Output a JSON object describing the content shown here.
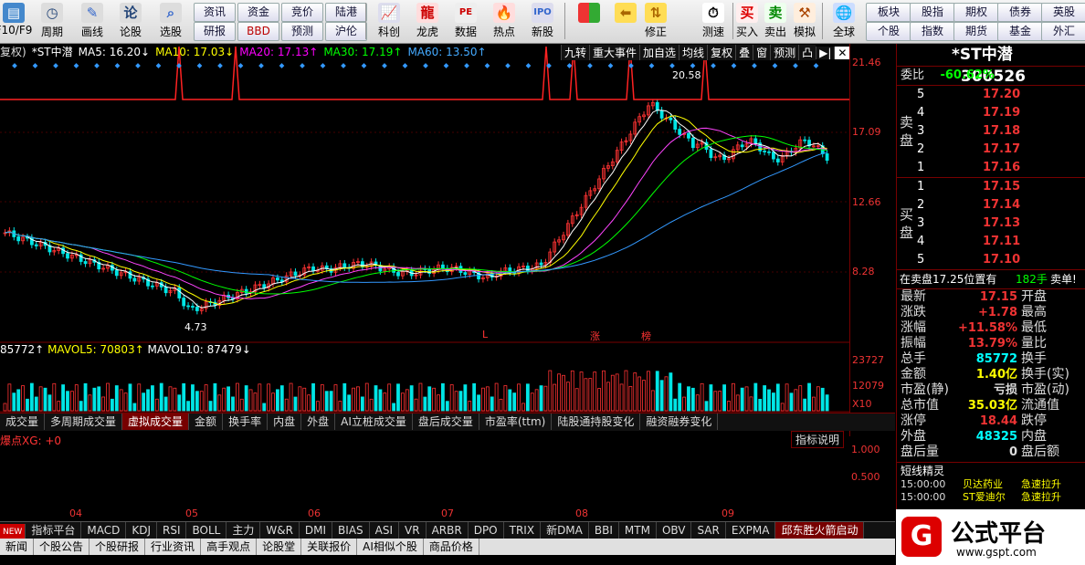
{
  "toolbar": {
    "buttons": [
      {
        "label": "F10/F9"
      },
      {
        "label": "周期"
      },
      {
        "label": "画线"
      },
      {
        "label": "论股"
      },
      {
        "label": "选股"
      },
      {
        "label": "科创"
      },
      {
        "label": "龙虎"
      },
      {
        "label": "数据"
      },
      {
        "label": "热点"
      },
      {
        "label": "新股"
      },
      {
        "label": "修正"
      },
      {
        "label": "测速"
      },
      {
        "label": "买入"
      },
      {
        "label": "卖出"
      },
      {
        "label": "模拟"
      },
      {
        "label": "全球"
      }
    ],
    "small": [
      "资讯",
      "资金",
      "竞价",
      "陆港",
      "研报",
      "BBD",
      "预测",
      "沪伦",
      "板块",
      "股指",
      "期权",
      "债券",
      "英股",
      "个股",
      "指数",
      "期货",
      "基金",
      "外汇"
    ]
  },
  "infobar": {
    "prefix": "复权)",
    "stock": "*ST中潜",
    "ma5": "MA5: 16.20↓",
    "ma10": "MA10: 17.03↓",
    "ma20": "MA20: 17.13↑",
    "ma30": "MA30: 17.19↑",
    "ma60": "MA60: 13.50↑"
  },
  "top_buttons": [
    "九转",
    "重大事件",
    "加自选",
    "均线",
    "复权",
    "叠",
    "窗",
    "预测",
    "凸"
  ],
  "price_axis": [
    "21.46",
    "17.09",
    "12.66",
    "8.28"
  ],
  "annotations": {
    "high": "20.58",
    "low": "4.73",
    "marker_l": "L",
    "marker_zhang": "涨",
    "marker_bang": "榜"
  },
  "volume": {
    "header_vol": "85772↑",
    "mavol5": "MAVOL5: 70803↑",
    "mavol10": "MAVOL10: 87479↓",
    "axis": [
      "23727",
      "12079",
      "X10"
    ]
  },
  "indicator_tabs": [
    "成交量",
    "多周期成交量",
    "虚拟成交量",
    "金额",
    "换手率",
    "内盘",
    "外盘",
    "AI立桩成交量",
    "盘后成交量",
    "市盈率(ttm)",
    "陆股通持股变化",
    "融资融券变化"
  ],
  "indicator": {
    "label": "爆点XG: +0",
    "help": "指标说明",
    "axis": [
      "1.000",
      "0.500"
    ]
  },
  "x_labels": [
    "04",
    "05",
    "06",
    "07",
    "08",
    "09"
  ],
  "bottom_tabs": [
    "NEW",
    "指标平台",
    "MACD",
    "KDJ",
    "RSI",
    "BOLL",
    "主力",
    "W&R",
    "DMI",
    "BIAS",
    "ASI",
    "VR",
    "ARBR",
    "DPO",
    "TRIX",
    "新DMA",
    "BBI",
    "MTM",
    "OBV",
    "SAR",
    "EXPMA",
    "邱东胜火箭启动"
  ],
  "news_tabs": [
    "新闻",
    "个股公告",
    "个股研报",
    "行业资讯",
    "高手观点",
    "论股堂",
    "关联报价",
    "AI相似个股",
    "商品价格"
  ],
  "panel": {
    "name": "*ST中潜",
    "code": "300526",
    "weibi_label": "委比",
    "weibi": "-60.62%",
    "sell_label": "卖盘",
    "buy_label": "买盘",
    "sells": [
      {
        "n": "5",
        "p": "17.20"
      },
      {
        "n": "4",
        "p": "17.19"
      },
      {
        "n": "3",
        "p": "17.18"
      },
      {
        "n": "2",
        "p": "17.17"
      },
      {
        "n": "1",
        "p": "17.16"
      }
    ],
    "buys": [
      {
        "n": "1",
        "p": "17.15"
      },
      {
        "n": "2",
        "p": "17.14"
      },
      {
        "n": "3",
        "p": "17.13"
      },
      {
        "n": "4",
        "p": "17.11"
      },
      {
        "n": "5",
        "p": "17.10"
      }
    ],
    "notice_pre": "在卖盘17.25位置有",
    "notice_qty": "182手",
    "notice_post": "卖单!",
    "stats": [
      {
        "l": "最新",
        "v": "17.15",
        "r": "开盘"
      },
      {
        "l": "涨跌",
        "v": "+1.78",
        "r": "最高"
      },
      {
        "l": "涨幅",
        "v": "+11.58%",
        "r": "最低"
      },
      {
        "l": "振幅",
        "v": "13.79%",
        "r": "量比"
      },
      {
        "l": "总手",
        "v": "85772",
        "r": "换手"
      },
      {
        "l": "金额",
        "v": "1.40亿",
        "r": "换手(实)"
      },
      {
        "l": "市盈(静)",
        "v": "亏损",
        "r": "市盈(动)"
      },
      {
        "l": "总市值",
        "v": "35.03亿",
        "r": "流通值"
      },
      {
        "l": "涨停",
        "v": "18.44",
        "r": "跌停"
      },
      {
        "l": "外盘",
        "v": "48325",
        "r": "内盘"
      },
      {
        "l": "盘后量",
        "v": "0",
        "r": "盘后额"
      }
    ],
    "jingling_title": "短线精灵",
    "jingling": [
      {
        "t": "15:00:00",
        "n": "贝达药业",
        "e": "急速拉升"
      },
      {
        "t": "15:00:00",
        "n": "ST爱迪尔",
        "e": "急速拉升"
      }
    ]
  },
  "logo": {
    "text": "公式平台",
    "url": "www.gspt.com"
  },
  "colors": {
    "up": "#ff3333",
    "down": "#00e5e5",
    "bg": "#000000"
  }
}
